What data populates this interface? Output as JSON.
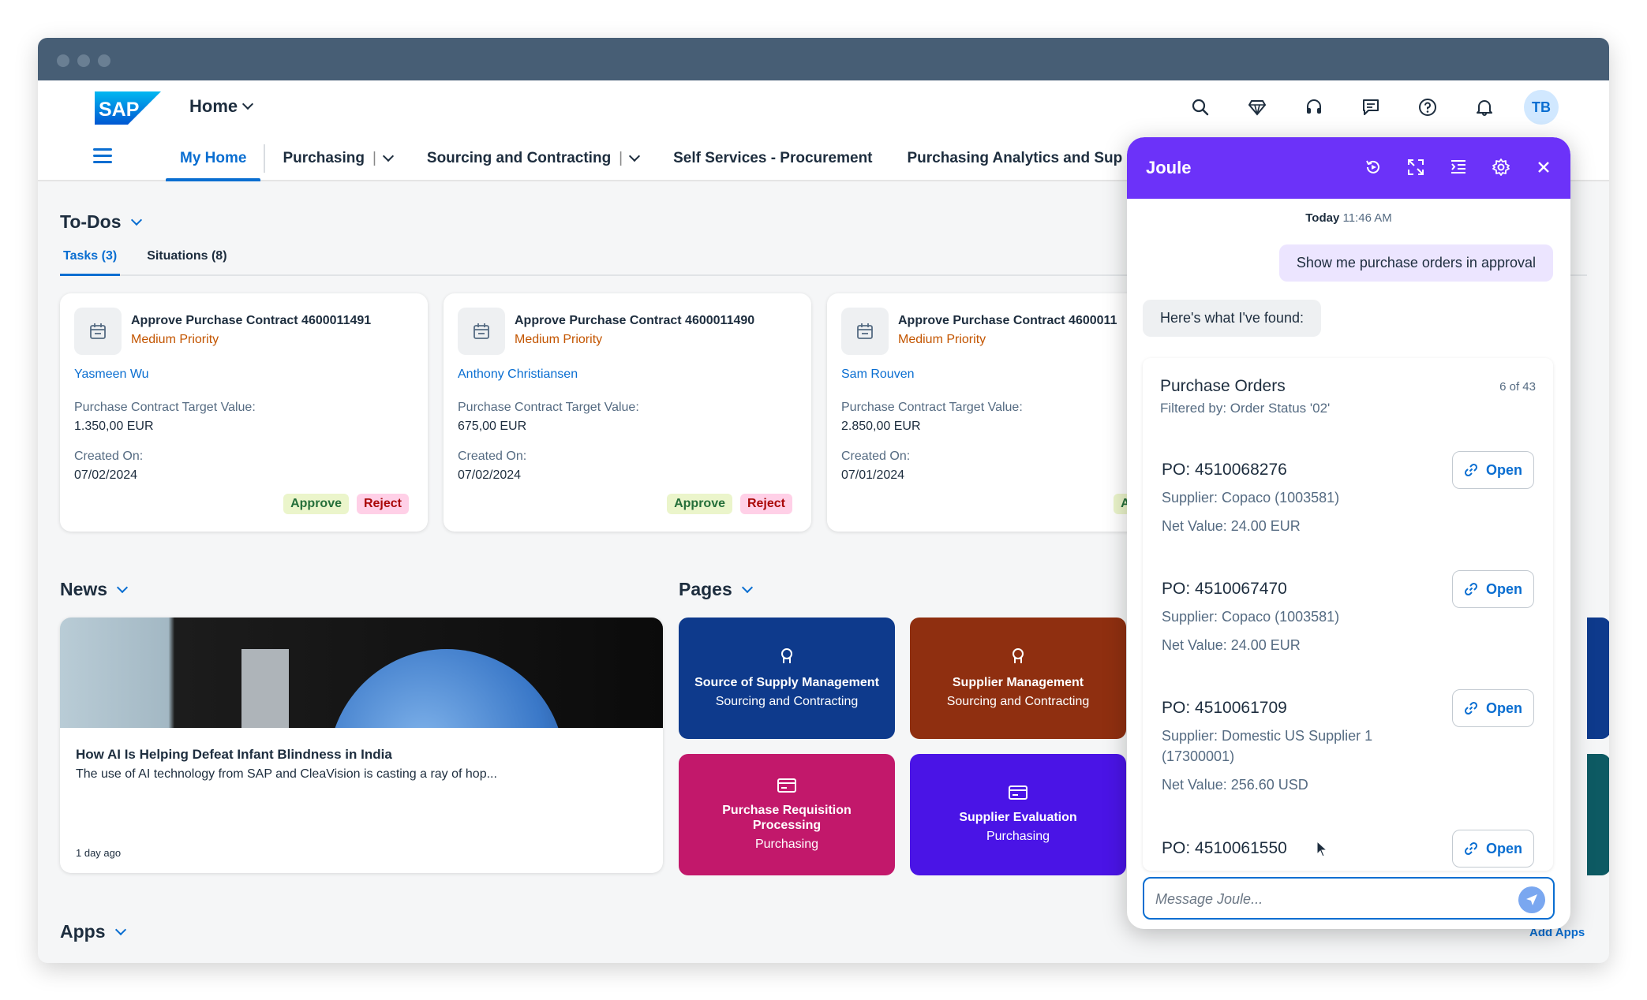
{
  "shell": {
    "home_label": "Home",
    "avatar_initials": "TB",
    "brand_color": "#0a6ed1"
  },
  "nav": {
    "tabs": [
      {
        "label": "My Home"
      },
      {
        "label": "Purchasing",
        "separator": "|"
      },
      {
        "label": "Sourcing and Contracting",
        "separator": "|"
      },
      {
        "label": "Self Services - Procurement"
      },
      {
        "label": "Purchasing Analytics and Sup"
      }
    ]
  },
  "todos": {
    "title": "To-Dos",
    "tabs": [
      "Tasks (3)",
      "Situations (8)"
    ],
    "cards": [
      {
        "title": "Approve Purchase Contract 4600011491",
        "priority": "Medium Priority",
        "person": "Yasmeen Wu",
        "value_label": "Purchase Contract Target Value:",
        "value": "1.350,00 EUR",
        "created_label": "Created On:",
        "created": "07/02/2024",
        "approve": "Approve",
        "reject": "Reject"
      },
      {
        "title": "Approve Purchase Contract 4600011490",
        "priority": "Medium Priority",
        "person": "Anthony Christiansen",
        "value_label": "Purchase Contract Target Value:",
        "value": "675,00 EUR",
        "created_label": "Created On:",
        "created": "07/02/2024",
        "approve": "Approve",
        "reject": "Reject"
      },
      {
        "title": "Approve Purchase Contract 4600011",
        "priority": "Medium Priority",
        "person": "Sam Rouven",
        "value_label": "Purchase Contract Target Value:",
        "value": "2.850,00 EUR",
        "created_label": "Created On:",
        "created": "07/01/2024",
        "approve": "Approve",
        "reject": ""
      }
    ]
  },
  "news": {
    "title": "News",
    "item": {
      "headline": "How AI Is Helping Defeat Infant Blindness in India",
      "summary": "The use of AI technology from SAP and CleaVision is casting a ray of hop...",
      "age": "1 day ago"
    }
  },
  "pages": {
    "title": "Pages",
    "tiles": [
      {
        "title": "Source of Supply Management",
        "subtitle": "Sourcing and Contracting",
        "color": "#0e3a8c"
      },
      {
        "title": "Supplier Management",
        "subtitle": "Sourcing and Contracting",
        "color": "#8f2f10"
      },
      {
        "title": "Purchase Requisition Processing",
        "subtitle": "Purchasing",
        "color": "#c2186b"
      },
      {
        "title": "Supplier Evaluation",
        "subtitle": "Purchasing",
        "color": "#4a14e6"
      }
    ]
  },
  "apps": {
    "title": "Apps",
    "add_apps": "Add Apps"
  },
  "joule": {
    "title": "Joule",
    "time_day": "Today",
    "time": "11:46 AM",
    "user_message": "Show me purchase orders in approval",
    "bot_message": "Here's what I've found:",
    "panel_title": "Purchase Orders",
    "panel_count": "6 of 43",
    "panel_filter": "Filtered by: Order Status '02'",
    "open_label": "Open",
    "orders": [
      {
        "po": "PO: 4510068276",
        "supplier": "Supplier: Copaco (1003581)",
        "net": "Net Value: 24.00 EUR"
      },
      {
        "po": "PO: 4510067470",
        "supplier": "Supplier: Copaco (1003581)",
        "net": "Net Value: 24.00 EUR"
      },
      {
        "po": "PO: 4510061709",
        "supplier": "Supplier: Domestic US Supplier 1 (17300001)",
        "net": "Net Value: 256.60 USD"
      },
      {
        "po": "PO: 4510061550",
        "supplier": "",
        "net": ""
      }
    ],
    "input_placeholder": "Message Joule...",
    "accent": "#6c32f9"
  }
}
